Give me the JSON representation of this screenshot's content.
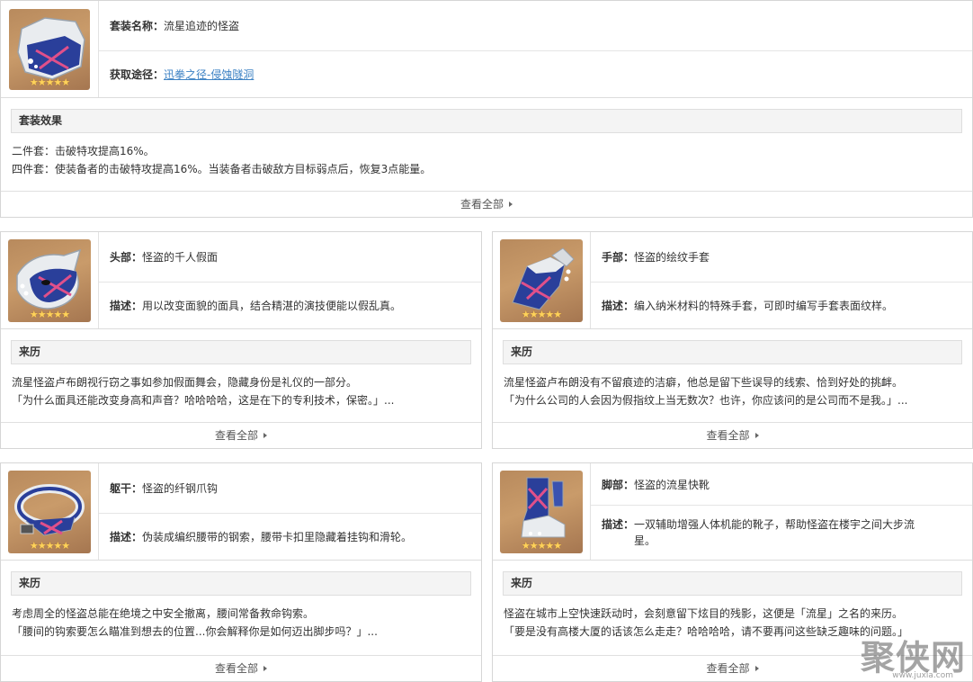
{
  "set": {
    "name_label": "套装名称：",
    "name": "流星追迹的怪盗",
    "source_label": "获取途径：",
    "source_link": "迅拳之径-侵蚀隧洞",
    "effect_title": "套装效果",
    "effect_lines": [
      "二件套：击破特攻提高16%。",
      "四件套：使装备者的击破特攻提高16%。当装备者击破敌方目标弱点后，恢复3点能量。"
    ],
    "more": "查看全部",
    "stars": "★★★★★"
  },
  "pieces": {
    "head": {
      "slot_label": "头部：",
      "name": "怪盗的千人假面",
      "desc_label": "描述：",
      "desc": "用以改变面貌的面具，结合精湛的演技便能以假乱真。",
      "story_title": "来历",
      "story_lines": [
        "流星怪盗卢布朗视行窃之事如参加假面舞会，隐藏身份是礼仪的一部分。",
        "「为什么面具还能改变身高和声音？哈哈哈哈，这是在下的专利技术，保密。」..."
      ],
      "more": "查看全部",
      "stars": "★★★★★"
    },
    "hands": {
      "slot_label": "手部：",
      "name": "怪盗的绘纹手套",
      "desc_label": "描述：",
      "desc": "编入纳米材料的特殊手套，可即时编写手套表面纹样。",
      "story_title": "来历",
      "story_lines": [
        "流星怪盗卢布朗没有不留痕迹的洁癖，他总是留下些误导的线索、恰到好处的挑衅。",
        "「为什么公司的人会因为假指纹上当无数次？也许，你应该问的是公司而不是我。」..."
      ],
      "more": "查看全部",
      "stars": "★★★★★"
    },
    "body": {
      "slot_label": "躯干：",
      "name": "怪盗的纤钢爪钩",
      "desc_label": "描述：",
      "desc": "伪装成编织腰带的钢索，腰带卡扣里隐藏着挂钩和滑轮。",
      "story_title": "来历",
      "story_lines": [
        "考虑周全的怪盗总能在绝境之中安全撤离，腰间常备救命钩索。",
        "「腰间的钩索要怎么瞄准到想去的位置...你会解释你是如何迈出脚步吗？」..."
      ],
      "more": "查看全部",
      "stars": "★★★★★"
    },
    "feet": {
      "slot_label": "脚部：",
      "name": "怪盗的流星快靴",
      "desc_label": "描述：",
      "desc_lines": [
        "一双辅助增强人体机能的靴子，帮助怪盗在楼宇之间大步流",
        "星。"
      ],
      "story_title": "来历",
      "story_lines": [
        "怪盗在城市上空快速跃动时，会刻意留下炫目的残影，这便是「流星」之名的来历。",
        "「要是没有高楼大厦的话该怎么走走？哈哈哈哈，请不要再问这些缺乏趣味的问题。」"
      ],
      "more": "查看全部",
      "stars": "★★★★★"
    }
  },
  "watermark": {
    "text": "聚侠网",
    "url": "www.juxia.com"
  },
  "colors": {
    "link": "#3d82c4",
    "thumb_bg": "#c99b6a",
    "star": "#ffd35a",
    "mask_blue": "#2a3f9a",
    "accent_pink": "#e0508a"
  }
}
